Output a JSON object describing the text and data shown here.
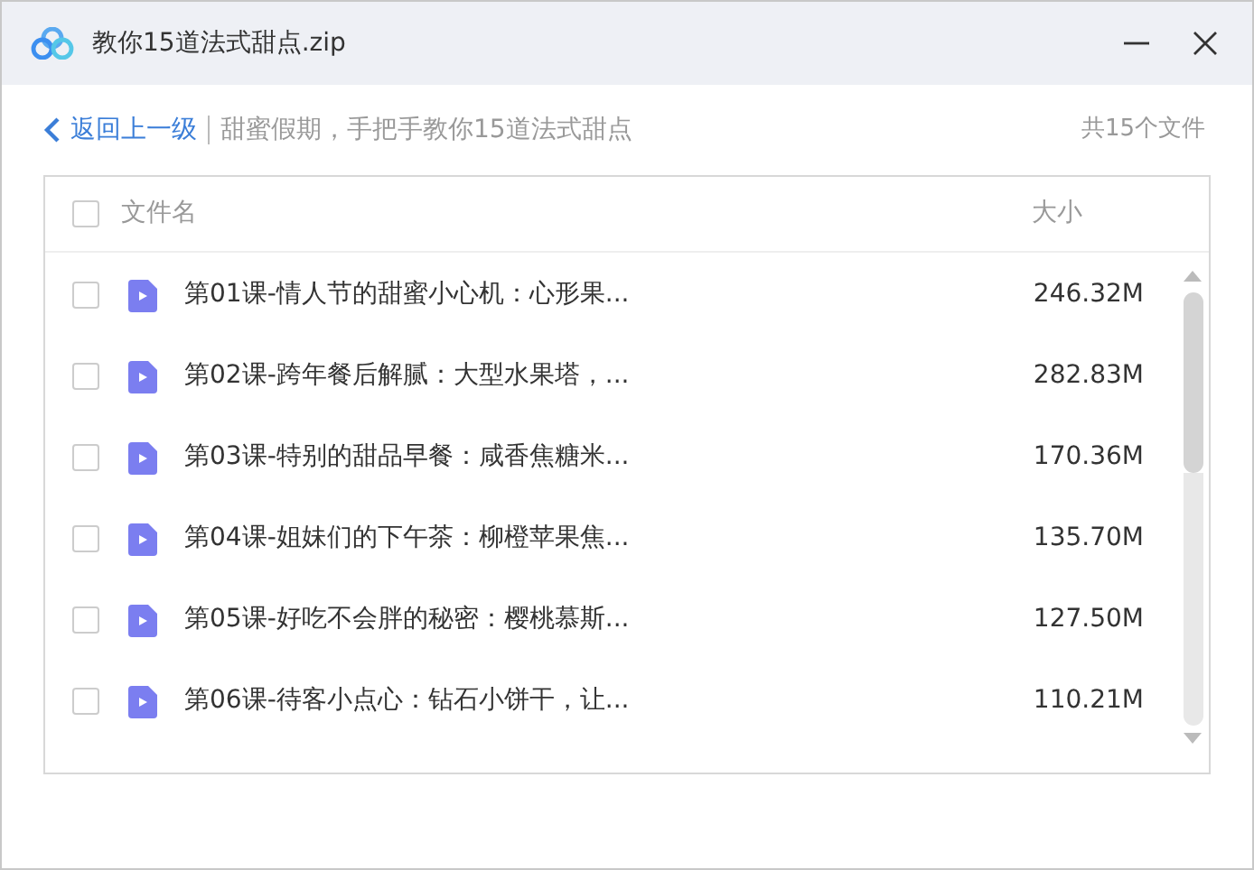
{
  "window": {
    "title": "教你15道法式甜点.zip"
  },
  "nav": {
    "back": "返回上一级",
    "path": "甜蜜假期，手把手教你15道法式甜点",
    "count": "共15个文件"
  },
  "table": {
    "columns": [
      "文件名",
      "大小"
    ],
    "header_checked": false,
    "rows": [
      {
        "name": "第01课-情人节的甜蜜小心机：心形果...",
        "size": "246.32M",
        "checked": false
      },
      {
        "name": "第02课-跨年餐后解腻：大型水果塔，...",
        "size": "282.83M",
        "checked": false
      },
      {
        "name": "第03课-特别的甜品早餐：咸香焦糖米...",
        "size": "170.36M",
        "checked": false
      },
      {
        "name": "第04课-姐妹们的下午茶：柳橙苹果焦...",
        "size": "135.70M",
        "checked": false
      },
      {
        "name": "第05课-好吃不会胖的秘密：樱桃慕斯...",
        "size": "127.50M",
        "checked": false
      },
      {
        "name": "第06课-待客小点心：钻石小饼干，让...",
        "size": "110.21M",
        "checked": false
      }
    ]
  }
}
